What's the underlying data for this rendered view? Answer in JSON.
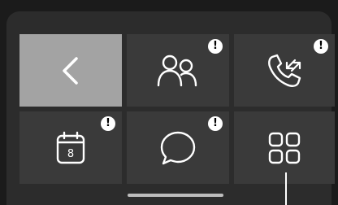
{
  "tiles": [
    {
      "icon": "back-chevron-icon",
      "active": true,
      "alert": false
    },
    {
      "icon": "contacts-icon",
      "active": false,
      "alert": true
    },
    {
      "icon": "call-log-icon",
      "active": false,
      "alert": true
    },
    {
      "icon": "calendar-icon",
      "active": false,
      "alert": true
    },
    {
      "icon": "messages-icon",
      "active": false,
      "alert": true
    },
    {
      "icon": "apps-grid-icon",
      "active": false,
      "alert": false
    }
  ],
  "calendar": {
    "day": "8"
  },
  "badge_symbol": "!",
  "colors": {
    "background": "#1b1b1b",
    "panel": "#2c2c2c",
    "tile": "#3a3a3a",
    "tile_active": "#a3a3a3",
    "icon": "#ffffff"
  }
}
